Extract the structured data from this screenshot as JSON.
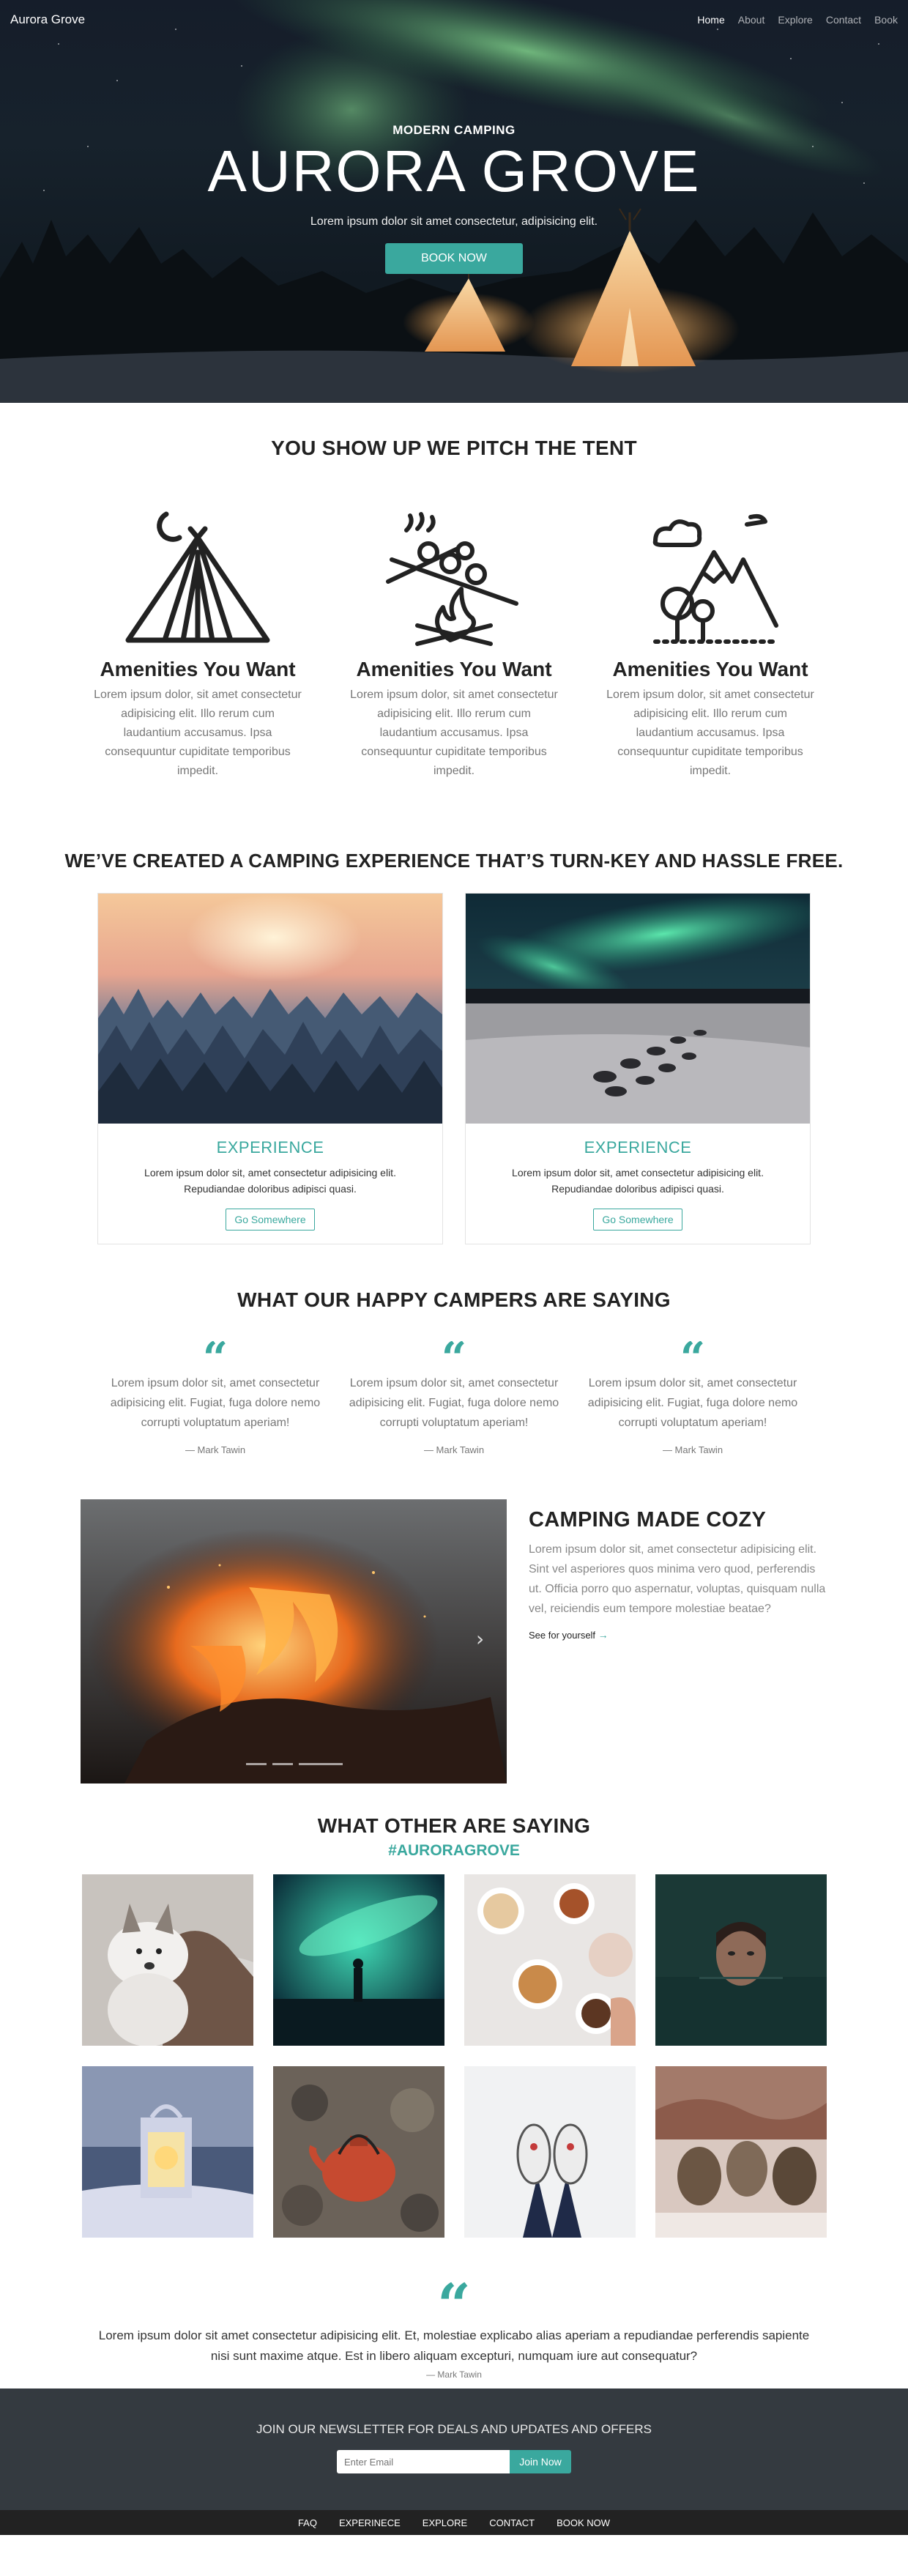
{
  "nav": {
    "brand": "Aurora Grove",
    "links": [
      "Home",
      "About",
      "Explore",
      "Contact",
      "Book"
    ]
  },
  "hero": {
    "eyebrow": "MODERN CAMPING",
    "title": "AURORA GROVE",
    "subtitle": "Lorem ipsum dolor sit amet consectetur, adipisicing elit.",
    "button": "BOOK NOW"
  },
  "amenities": {
    "title": "YOU SHOW UP WE PITCH THE TENT",
    "items": [
      {
        "icon": "tent-moon-icon",
        "heading": "Amenities You Want",
        "text": "Lorem ipsum dolor, sit amet consectetur adipisicing elit. Illo rerum cum laudantium accusamus. Ipsa consequuntur cupiditate temporibus impedit."
      },
      {
        "icon": "campfire-marshmallow-icon",
        "heading": "Amenities You Want",
        "text": "Lorem ipsum dolor, sit amet consectetur adipisicing elit. Illo rerum cum laudantium accusamus. Ipsa consequuntur cupiditate temporibus impedit."
      },
      {
        "icon": "mountain-tree-icon",
        "heading": "Amenities You Want",
        "text": "Lorem ipsum dolor, sit amet consectetur adipisicing elit. Illo rerum cum laudantium accusamus. Ipsa consequuntur cupiditate temporibus impedit."
      }
    ]
  },
  "experience": {
    "title": "WE’VE CREATED A CAMPING EXPERIENCE THAT’S TURN-KEY AND HASSLE FREE.",
    "cards": [
      {
        "heading": "EXPERIENCE",
        "text": "Lorem ipsum dolor sit, amet consectetur adipisicing elit. Repudiandae doloribus adipisci quasi.",
        "button": "Go Somewhere"
      },
      {
        "heading": "EXPERIENCE",
        "text": "Lorem ipsum dolor sit, amet consectetur adipisicing elit. Repudiandae doloribus adipisci quasi.",
        "button": "Go Somewhere"
      }
    ]
  },
  "testimonials": {
    "title": "WHAT OUR HAPPY CAMPERS ARE SAYING",
    "quote_mark": "“",
    "items": [
      {
        "text": "Lorem ipsum dolor sit, amet consectetur adipisicing elit. Fugiat, fuga dolore nemo corrupti voluptatum aperiam!",
        "author": "— Mark Tawin"
      },
      {
        "text": "Lorem ipsum dolor sit, amet consectetur adipisicing elit. Fugiat, fuga dolore nemo corrupti voluptatum aperiam!",
        "author": "— Mark Tawin"
      },
      {
        "text": "Lorem ipsum dolor sit, amet consectetur adipisicing elit. Fugiat, fuga dolore nemo corrupti voluptatum aperiam!",
        "author": "— Mark Tawin"
      }
    ]
  },
  "cozy": {
    "heading": "CAMPING MADE COZY",
    "text": "Lorem ipsum dolor sit, amet consectetur adipisicing elit. Sint vel asperiores quos minima vero quod, perferendis ut. Officia porro quo aspernatur, voluptas, quisquam nulla vel, reiciendis eum tempore molestiae beatae?",
    "link": "See for yourself",
    "arrow": "→",
    "carousel_next": "›"
  },
  "gallery": {
    "title": "WHAT OTHER ARE SAYING",
    "hashtag": "#AURORAGROVE"
  },
  "big_quote": {
    "quote_mark": "“",
    "text": "Lorem ipsum dolor sit amet consectetur adipisicing elit. Et, molestiae explicabo alias aperiam a repudiandae perferendis sapiente nisi sunt maxime atque. Est in libero aliquam excepturi, numquam iure aut consequatur?",
    "author": "— Mark Tawin"
  },
  "newsletter": {
    "heading": "JOIN OUR NEWSLETTER FOR DEALS AND UPDATES AND OFFERS",
    "placeholder": "Enter Email",
    "button": "Join Now"
  },
  "footer": {
    "links": [
      "FAQ",
      "EXPERINECE",
      "EXPLORE",
      "CONTACT",
      "BOOK NOW"
    ]
  },
  "colors": {
    "accent": "#3aa89e",
    "newsletter_bg": "#343a40",
    "footer_bg": "#222222"
  }
}
